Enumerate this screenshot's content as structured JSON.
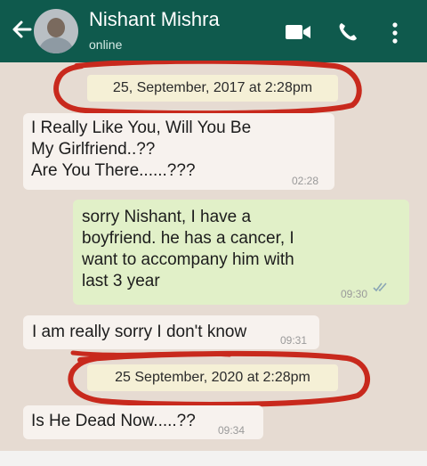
{
  "header": {
    "contact_name": "Nishant Mishra",
    "status": "online",
    "icons": [
      "back-arrow-icon",
      "avatar",
      "video-call-icon",
      "phone-icon",
      "more-options-icon"
    ],
    "color": "#0f5a4d"
  },
  "chat": {
    "date_chip_1": "25, September, 2017 at 2:28pm",
    "date_chip_2": "25 September, 2020 at 2:28pm",
    "messages": [
      {
        "direction": "incoming",
        "lines": [
          "I Really Like You, Will You Be",
          "My Girlfriend..??",
          "Are You There......???"
        ],
        "time": "02:28"
      },
      {
        "direction": "outgoing",
        "lines": [
          "sorry Nishant, I have a",
          "boyfriend. he has a cancer, I",
          "want to accompany him with",
          "last 3 year"
        ],
        "time": "09:30",
        "status_icon": "double-check-icon"
      },
      {
        "direction": "incoming",
        "lines": [
          "I am really sorry I don't know"
        ],
        "time": "09:31"
      },
      {
        "direction": "incoming",
        "lines": [
          "Is He Dead Now.....??"
        ],
        "time": "09:34"
      }
    ],
    "annotation_color": "#c8291d"
  }
}
